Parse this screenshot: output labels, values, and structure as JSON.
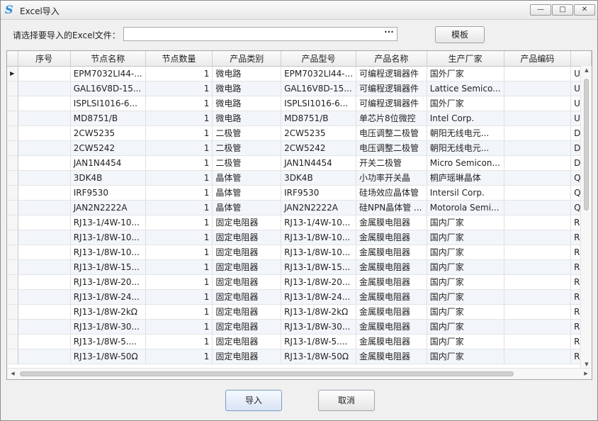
{
  "window": {
    "title": "Excel导入",
    "minimize": "—",
    "maximize": "□",
    "close": "✕",
    "icon": "app-logo-icon"
  },
  "file": {
    "label": "请选择要导入的Excel文件：",
    "value": "",
    "browse": "···"
  },
  "template_button": "模板",
  "table": {
    "columns": [
      "序号",
      "节点名称",
      "节点数量",
      "产品类别",
      "产品型号",
      "产品名称",
      "生产厂家",
      "产品编码",
      ""
    ],
    "rows": [
      [
        "",
        "EPM7032LI44-...",
        "1",
        "微电路",
        "EPM7032LI44-...",
        "可编程逻辑器件",
        "国外厂家",
        "",
        "U"
      ],
      [
        "",
        "GAL16V8D-15...",
        "1",
        "微电路",
        "GAL16V8D-15...",
        "可编程逻辑器件",
        "Lattice Semico...",
        "",
        "U"
      ],
      [
        "",
        "ISPLSI1016-6...",
        "1",
        "微电路",
        "ISPLSI1016-6...",
        "可编程逻辑器件",
        "国外厂家",
        "",
        "U"
      ],
      [
        "",
        "MD8751/B",
        "1",
        "微电路",
        "MD8751/B",
        "单芯片8位微控",
        "Intel Corp.",
        "",
        "U"
      ],
      [
        "",
        "2CW5235",
        "1",
        "二极管",
        "2CW5235",
        "电压调整二极管",
        "朝阳无线电元...",
        "",
        "D"
      ],
      [
        "",
        "2CW5242",
        "1",
        "二极管",
        "2CW5242",
        "电压调整二极管",
        "朝阳无线电元...",
        "",
        "D"
      ],
      [
        "",
        "JAN1N4454",
        "1",
        "二极管",
        "JAN1N4454",
        "开关二极管",
        "Micro Semicon...",
        "",
        "D"
      ],
      [
        "",
        "3DK4B",
        "1",
        "晶体管",
        "3DK4B",
        "小功率开关晶",
        "桐庐瑶琳晶体",
        "",
        "Q"
      ],
      [
        "",
        "IRF9530",
        "1",
        "晶体管",
        "IRF9530",
        "硅场效应晶体管",
        "Intersil Corp.",
        "",
        "Q"
      ],
      [
        "",
        "JAN2N2222A",
        "1",
        "晶体管",
        "JAN2N2222A",
        "硅NPN晶体管 ...",
        "Motorola Semi...",
        "",
        "Q"
      ],
      [
        "",
        "RJ13-1/4W-10...",
        "1",
        "固定电阻器",
        "RJ13-1/4W-10...",
        "金属膜电阻器",
        "国内厂家",
        "",
        "R"
      ],
      [
        "",
        "RJ13-1/8W-10...",
        "1",
        "固定电阻器",
        "RJ13-1/8W-10...",
        "金属膜电阻器",
        "国内厂家",
        "",
        "R"
      ],
      [
        "",
        "RJ13-1/8W-10...",
        "1",
        "固定电阻器",
        "RJ13-1/8W-10...",
        "金属膜电阻器",
        "国内厂家",
        "",
        "R"
      ],
      [
        "",
        "RJ13-1/8W-15...",
        "1",
        "固定电阻器",
        "RJ13-1/8W-15...",
        "金属膜电阻器",
        "国内厂家",
        "",
        "R"
      ],
      [
        "",
        "RJ13-1/8W-20...",
        "1",
        "固定电阻器",
        "RJ13-1/8W-20...",
        "金属膜电阻器",
        "国内厂家",
        "",
        "R"
      ],
      [
        "",
        "RJ13-1/8W-24...",
        "1",
        "固定电阻器",
        "RJ13-1/8W-24...",
        "金属膜电阻器",
        "国内厂家",
        "",
        "R"
      ],
      [
        "",
        "RJ13-1/8W-2kΩ",
        "1",
        "固定电阻器",
        "RJ13-1/8W-2kΩ",
        "金属膜电阻器",
        "国内厂家",
        "",
        "R"
      ],
      [
        "",
        "RJ13-1/8W-30...",
        "1",
        "固定电阻器",
        "RJ13-1/8W-30...",
        "金属膜电阻器",
        "国内厂家",
        "",
        "R"
      ],
      [
        "",
        "RJ13-1/8W-5....",
        "1",
        "固定电阻器",
        "RJ13-1/8W-5....",
        "金属膜电阻器",
        "国内厂家",
        "",
        "R"
      ],
      [
        "",
        "RJ13-1/8W-50Ω",
        "1",
        "固定电阻器",
        "RJ13-1/8W-50Ω",
        "金属膜电阻器",
        "国内厂家",
        "",
        "R"
      ]
    ],
    "current_row_marker": "▶"
  },
  "scrollbars": {
    "up": "▲",
    "down": "▼",
    "left": "◀",
    "right": "▶"
  },
  "buttons": {
    "import": "导入",
    "cancel": "取消"
  }
}
